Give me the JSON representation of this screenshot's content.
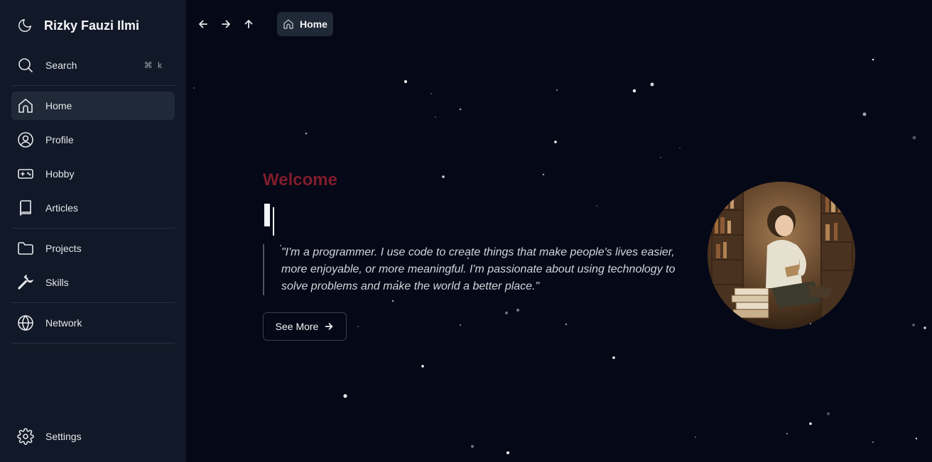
{
  "sidebar": {
    "brand": {
      "name": "Rizky Fauzi Ilmi",
      "icon": "moon-icon"
    },
    "search": {
      "label": "Search",
      "shortcut": "⌘ k",
      "icon": "search-icon"
    },
    "items": [
      {
        "label": "Home",
        "icon": "home-icon",
        "active": true
      },
      {
        "label": "Profile",
        "icon": "user-circle-icon"
      },
      {
        "label": "Hobby",
        "icon": "gamepad-icon"
      },
      {
        "label": "Articles",
        "icon": "book-icon"
      },
      {
        "label": "Projects",
        "icon": "folder-icon"
      },
      {
        "label": "Skills",
        "icon": "wrench-icon"
      },
      {
        "label": "Network",
        "icon": "globe-icon"
      }
    ],
    "settings": {
      "label": "Settings",
      "icon": "gear-icon"
    }
  },
  "toolbar": {
    "back_icon": "arrow-left-icon",
    "forward_icon": "arrow-right-icon",
    "up_icon": "arrow-up-icon",
    "breadcrumb": {
      "label": "Home",
      "icon": "home-icon"
    }
  },
  "hero": {
    "welcome": "Welcome",
    "typed_text": "I",
    "quote": "\"I'm a programmer. I use code to create things that make people's lives easier, more enjoyable, or more meaningful. I'm passionate about using technology to solve problems and make the world a better place.\"",
    "button_label": "See More"
  },
  "colors": {
    "background": "#050816",
    "sidebar": "#111827",
    "accent": "#7f1d2d",
    "active_item": "#1f2937"
  }
}
